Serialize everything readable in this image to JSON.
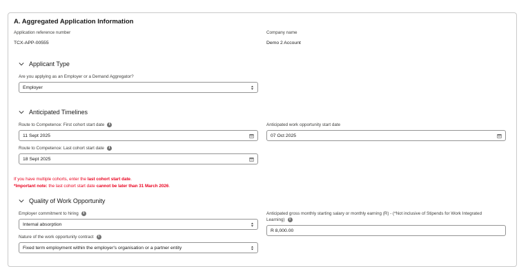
{
  "section_a": {
    "title": "A. Aggregated Application Information",
    "app_ref_label": "Application reference number",
    "app_ref_value": "TCX-APP-00555",
    "company_label": "Company name",
    "company_value": "Demo 2 Account"
  },
  "applicant_type": {
    "title": "Applicant Type",
    "question": "Are you applying as an Employer or a Demand Aggregator?",
    "selected": "Employer"
  },
  "timelines": {
    "title": "Anticipated Timelines",
    "first_cohort_label": "Route to Competence: First cohort start date",
    "first_cohort_value": "11 Sept 2025",
    "last_cohort_label": "Route to Competence: Last cohort start date",
    "last_cohort_value": "18 Sept 2025",
    "work_start_label": "Anticipated work opportunity start date",
    "work_start_value": "07 Oct 2025"
  },
  "notes": {
    "line1_a": "If you have multiple cohorts, enter the ",
    "line1_b": "last cohort start date",
    "line1_c": ".",
    "line2_a": "*Important note:",
    "line2_b": " the last cohort start date ",
    "line2_c": "cannot be later than 31 March 2026",
    "line2_d": "."
  },
  "quality": {
    "title": "Quality of Work Opportunity",
    "commitment_label": "Employer commitment to hiring",
    "commitment_value": "Internal absorption",
    "contract_label": "Nature of the work opportunity contract",
    "contract_value": "Fixed term employment within the employer's organisation or a partner entity",
    "salary_label_1": "Anticipated gross monthly starting salary or monthly earning (R) - (*Not inclusive of Stipends for Work Integrated",
    "salary_label_2": "Learning)",
    "salary_value": "R 8,000.00"
  },
  "icons": {
    "info": "info-icon",
    "chevron": "chevron-down-icon",
    "calendar": "calendar-icon",
    "select": "select-arrows-icon",
    "info_glyph": "i"
  },
  "colors": {
    "error_red": "#ea001e",
    "border": "#939393",
    "card_border": "#c9c9c9"
  }
}
